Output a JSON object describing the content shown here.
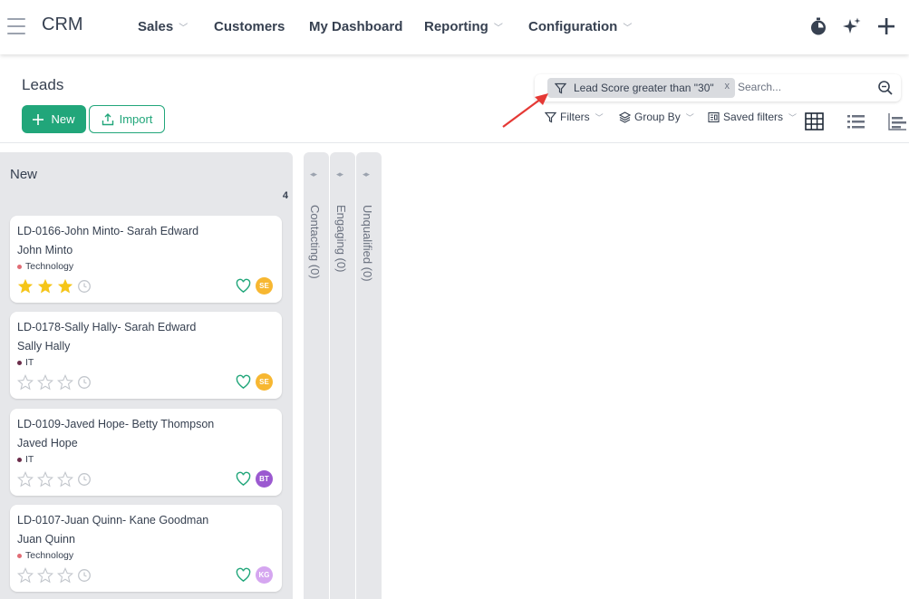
{
  "app": {
    "brand": "CRM"
  },
  "nav": {
    "items": [
      {
        "label": "Sales",
        "has_menu": true
      },
      {
        "label": "Customers",
        "has_menu": false
      },
      {
        "label": "My Dashboard",
        "has_menu": false
      },
      {
        "label": "Reporting",
        "has_menu": true
      },
      {
        "label": "Configuration",
        "has_menu": true
      }
    ],
    "right_icons": [
      "stopwatch-icon",
      "sparkle-icon",
      "plus-icon"
    ]
  },
  "control": {
    "title": "Leads",
    "new_label": "New",
    "import_label": "Import",
    "search": {
      "facet_label": "Lead Score greater than \"30\"",
      "facet_remove": "x",
      "placeholder": "Search..."
    },
    "filters_label": "Filters",
    "groupby_label": "Group By",
    "saved_filters_label": "Saved filters",
    "views": [
      "kanban-view-icon",
      "list-view-icon",
      "graph-view-icon"
    ]
  },
  "kanban": {
    "main_column": {
      "title": "New",
      "count": "4",
      "cards": [
        {
          "title": "LD-0166-John Minto- Sarah Edward",
          "name": "John Minto",
          "tag": "Technology",
          "tag_color": "#e06c75",
          "stars": 3,
          "avatar": "SE",
          "avatar_color": "#f7b731"
        },
        {
          "title": "LD-0178-Sally Hally- Sarah Edward",
          "name": "Sally Hally",
          "tag": "IT",
          "tag_color": "#6b2d4a",
          "stars": 0,
          "avatar": "SE",
          "avatar_color": "#f7b731"
        },
        {
          "title": "LD-0109-Javed Hope- Betty Thompson",
          "name": "Javed Hope",
          "tag": "IT",
          "tag_color": "#6b2d4a",
          "stars": 0,
          "avatar": "BT",
          "avatar_color": "#9b59d0"
        },
        {
          "title": "LD-0107-Juan Quinn- Kane Goodman",
          "name": "Juan Quinn",
          "tag": "Technology",
          "tag_color": "#e06c75",
          "stars": 0,
          "avatar": "KG",
          "avatar_color": "#d5a6f0"
        }
      ]
    },
    "folded_columns": [
      {
        "label": "Contacting (0)"
      },
      {
        "label": "Engaging (0)"
      },
      {
        "label": "Unqualified (0)"
      }
    ]
  },
  "colors": {
    "accent": "#21a67a",
    "star_on": "#f5c518",
    "arrow": "#e53935"
  }
}
